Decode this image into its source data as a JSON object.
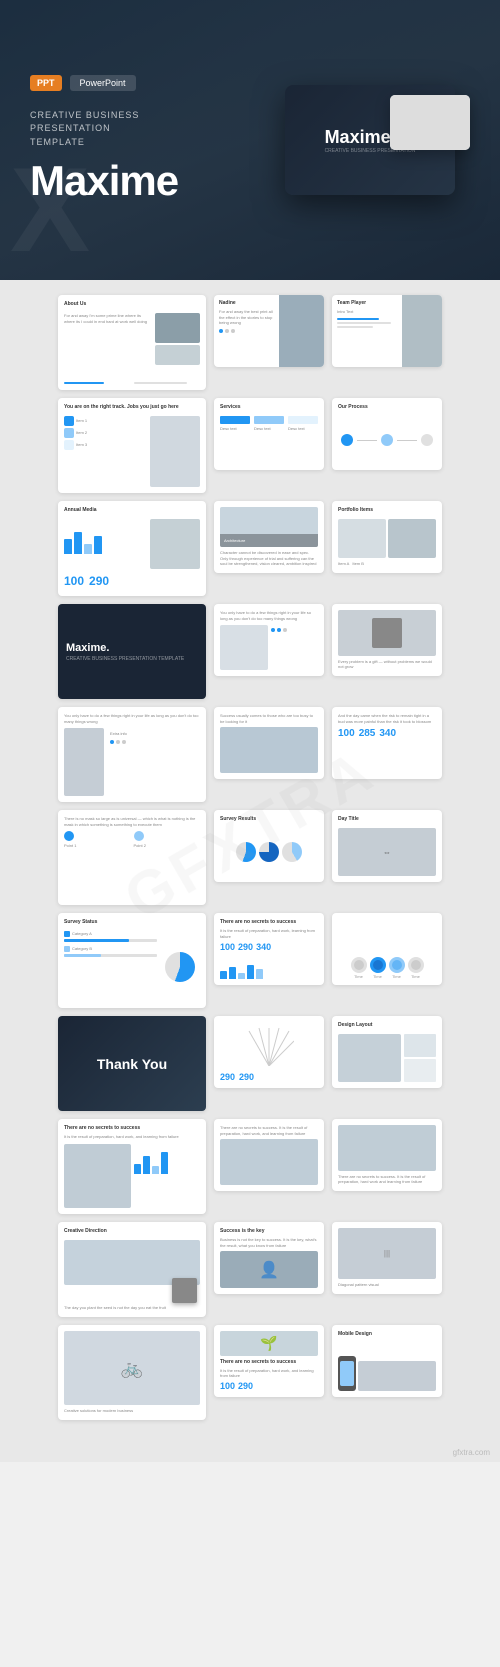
{
  "hero": {
    "badge_ppt": "PPT",
    "badge_pp": "PowerPoint",
    "subtitle": "CREATIVE BUSINESS\nPRESENTATION\nTEMPLATE",
    "title": "Maxime",
    "mockup_title": "Maxime."
  },
  "watermark": "GFXTRA",
  "slides": {
    "thank_you": "Thank You",
    "maxime": "Maxime.",
    "maxime_sub": "CREATIVE BUSINESS PRESENTATION TEMPLATE",
    "stat1": "100",
    "stat2": "290",
    "stat3": "340"
  }
}
